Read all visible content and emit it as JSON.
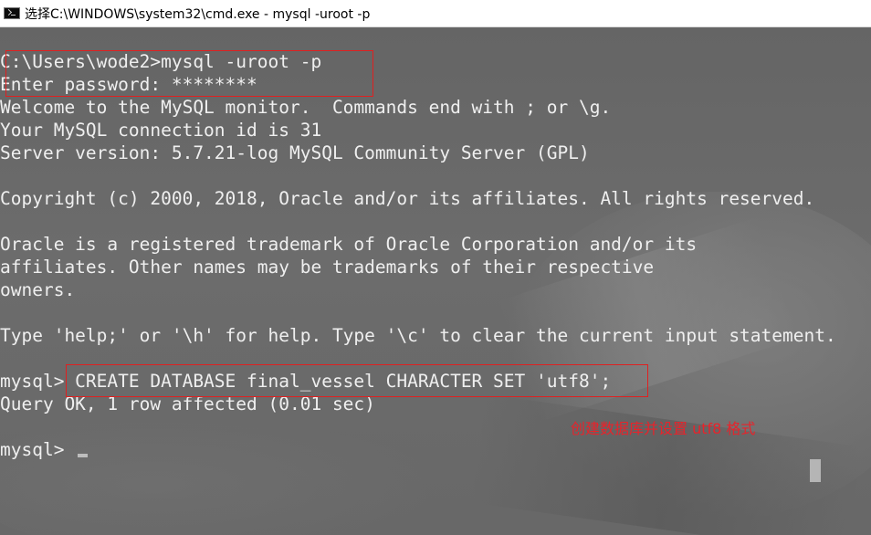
{
  "window": {
    "title": "选择C:\\WINDOWS\\system32\\cmd.exe - mysql  -uroot -p",
    "icon": "cmd-console-icon"
  },
  "console": {
    "lines": [
      "C:\\Users\\wode2>mysql -uroot -p",
      "Enter password: ********",
      "Welcome to the MySQL monitor.  Commands end with ; or \\g.",
      "Your MySQL connection id is 31",
      "Server version: 5.7.21-log MySQL Community Server (GPL)",
      "",
      "Copyright (c) 2000, 2018, Oracle and/or its affiliates. All rights reserved.",
      "",
      "Oracle is a registered trademark of Oracle Corporation and/or its",
      "affiliates. Other names may be trademarks of their respective",
      "owners.",
      "",
      "Type 'help;' or '\\h' for help. Type '\\c' to clear the current input statement.",
      "",
      "mysql> CREATE DATABASE final_vessel CHARACTER SET 'utf8';",
      "Query OK, 1 row affected (0.01 sec)",
      "",
      "mysql> "
    ]
  },
  "annotations": {
    "note": "创建数据库并设置 utf8 格式",
    "color": "#e8232b"
  },
  "colors": {
    "console_text": "#efefef",
    "console_bg": "#676767",
    "highlight_border": "#e02020"
  }
}
